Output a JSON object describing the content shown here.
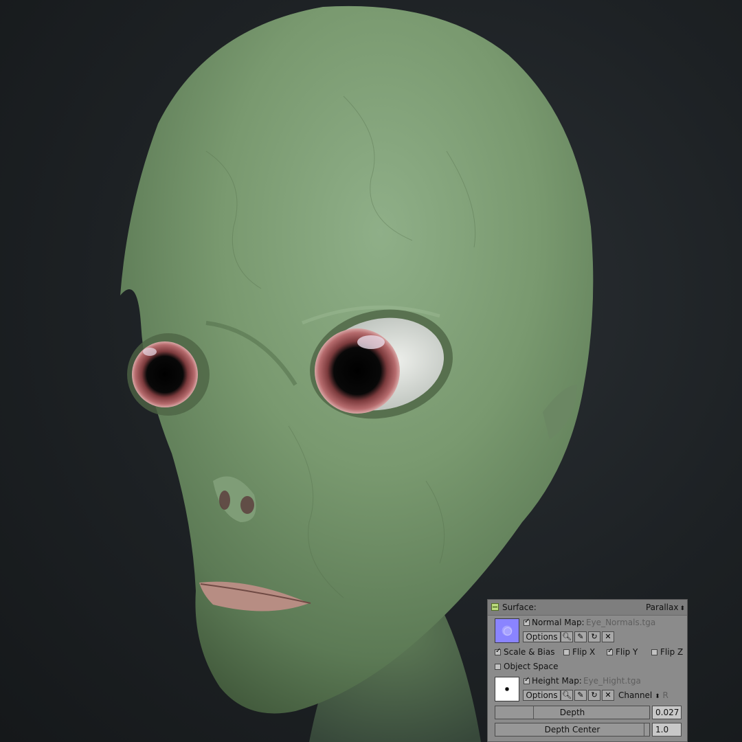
{
  "surface_panel": {
    "header": {
      "title": "Surface:",
      "mode": "Parallax"
    },
    "normal_map": {
      "checked": true,
      "label": "Normal Map:",
      "file": "Eye_Normals.tga"
    },
    "options_label": "Options",
    "scale_bias": {
      "label": "Scale & Bias",
      "checked": true
    },
    "flip_x": {
      "label": "Flip X",
      "checked": false
    },
    "flip_y": {
      "label": "Flip Y",
      "checked": true
    },
    "flip_z": {
      "label": "Flip Z",
      "checked": false
    },
    "object_space": {
      "label": "Object Space",
      "checked": false
    },
    "height_map": {
      "checked": true,
      "label": "Height Map:",
      "file": "Eye_Hight.tga"
    },
    "channel": {
      "label": "Channel",
      "value": "R"
    },
    "depth": {
      "label": "Depth",
      "value": "0.027",
      "level": 0.027
    },
    "depth_center": {
      "label": "Depth Center",
      "value": "1.0",
      "level": 1.0
    }
  },
  "icons": [
    "search-icon",
    "pencil-icon",
    "reload-icon",
    "close-icon"
  ]
}
